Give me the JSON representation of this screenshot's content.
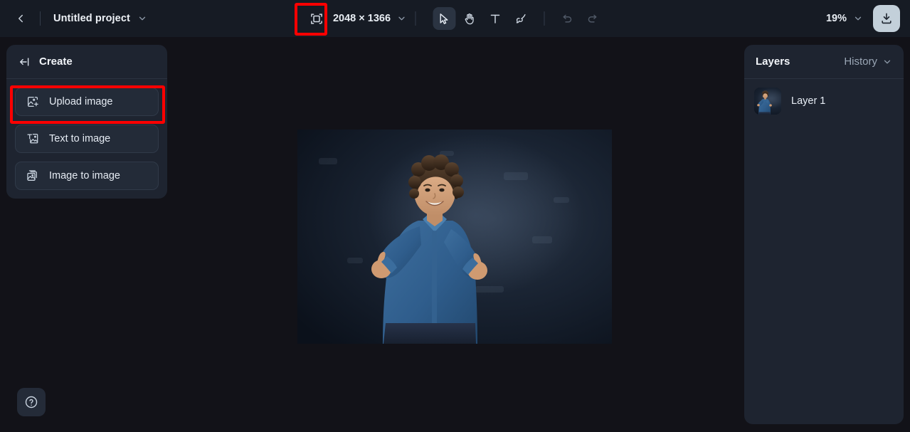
{
  "topbar": {
    "back_icon": "chevron-left-icon",
    "project_name": "Untitled project",
    "project_dropdown_icon": "chevron-down-icon",
    "canvas_resize_icon": "canvas-resize-icon",
    "canvas_dimensions": "2048 × 1366",
    "canvas_dropdown_icon": "chevron-down-icon",
    "tools": [
      {
        "name": "select-tool",
        "icon": "cursor-arrow-icon",
        "active": true,
        "disabled": false
      },
      {
        "name": "hand-tool",
        "icon": "hand-icon",
        "active": false,
        "disabled": false
      },
      {
        "name": "text-tool",
        "icon": "text-t-icon",
        "active": false,
        "disabled": false
      },
      {
        "name": "brush-tool",
        "icon": "paintbrush-icon",
        "active": false,
        "disabled": false
      },
      {
        "name": "undo-button",
        "icon": "undo-arrow-icon",
        "active": false,
        "disabled": true
      },
      {
        "name": "redo-button",
        "icon": "redo-arrow-icon",
        "active": false,
        "disabled": true
      }
    ],
    "zoom_level": "19%",
    "zoom_dropdown_icon": "chevron-down-icon",
    "download_icon": "download-icon"
  },
  "create_panel": {
    "collapse_icon": "collapse-left-icon",
    "title": "Create",
    "items": [
      {
        "label": "Upload image",
        "icon": "image-plus-icon",
        "highlighted": true
      },
      {
        "label": "Text to image",
        "icon": "text-to-image-icon",
        "highlighted": false
      },
      {
        "label": "Image to image",
        "icon": "image-to-image-icon",
        "highlighted": false
      }
    ]
  },
  "layers_panel": {
    "tab_layers": "Layers",
    "tab_history": "History",
    "history_dropdown_icon": "chevron-down-icon",
    "layers": [
      {
        "name": "Layer 1",
        "thumbnail": "child-thumbs-up-photo-thumbnail"
      }
    ]
  },
  "canvas": {
    "artboard_image": "photo-of-smiling-curly-haired-boy-in-blue-denim-shirt-giving-two-thumbs-up-on-dark-backdrop"
  },
  "help": {
    "icon": "question-mark-circle-icon"
  },
  "colors": {
    "app_background": "#121218",
    "topbar_background": "#161b24",
    "panel_background": "#1e2430",
    "panel_item_background": "#232b38",
    "accent_download_button": "#c3d0da",
    "annotation_red": "#fe0000",
    "text_primary": "#eef2f7",
    "text_muted": "#9aa6b5"
  },
  "annotations": [
    {
      "name": "canvas-resize-icon-highlight",
      "color": "#fe0000"
    },
    {
      "name": "upload-image-button-highlight",
      "color": "#fe0000"
    }
  ]
}
